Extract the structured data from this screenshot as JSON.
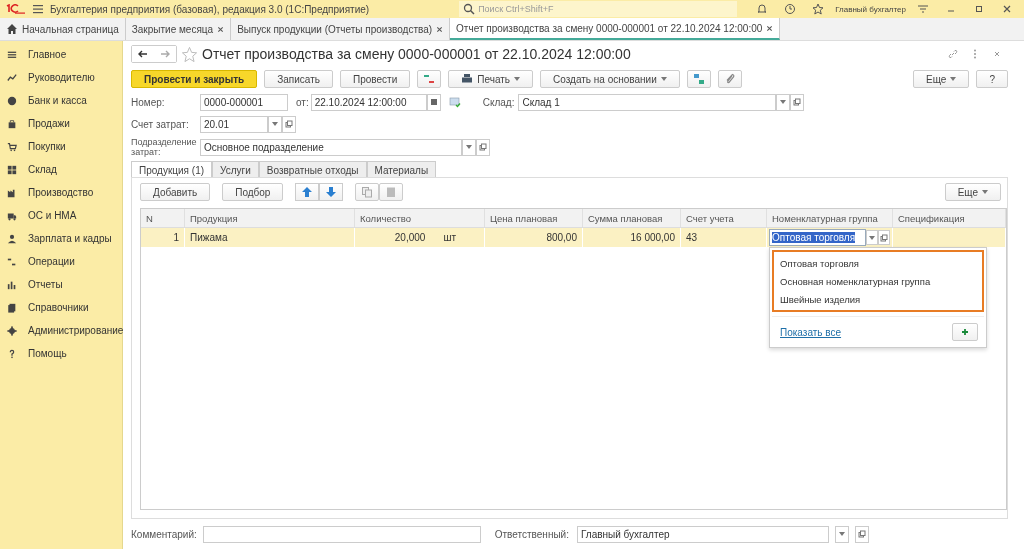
{
  "app_bar": {
    "title": "Бухгалтерия предприятия (базовая), редакция 3.0  (1С:Предприятие)",
    "search": {
      "placeholder": "Поиск Ctrl+Shift+F"
    },
    "user": "Главный бухгалтер"
  },
  "open_tabs": [
    {
      "label": "Начальная страница",
      "kind": "home",
      "selected": false
    },
    {
      "label": "Закрытие месяца",
      "kind": "closable",
      "selected": false
    },
    {
      "label": "Выпуск продукции (Отчеты производства)",
      "kind": "closable",
      "selected": false
    },
    {
      "label": "Отчет производства за смену 0000-000001 от 22.10.2024 12:00:00",
      "kind": "closable",
      "selected": true
    }
  ],
  "sidebar": {
    "items": [
      {
        "label": "Главное"
      },
      {
        "label": "Руководителю"
      },
      {
        "label": "Банк и касса"
      },
      {
        "label": "Продажи"
      },
      {
        "label": "Покупки"
      },
      {
        "label": "Склад"
      },
      {
        "label": "Производство"
      },
      {
        "label": "ОС и НМА"
      },
      {
        "label": "Зарплата и кадры"
      },
      {
        "label": "Операции"
      },
      {
        "label": "Отчеты"
      },
      {
        "label": "Справочники"
      },
      {
        "label": "Администрирование"
      },
      {
        "label": "Помощь"
      }
    ]
  },
  "document": {
    "title": "Отчет производства за смену 0000-000001 от 22.10.2024 12:00:00",
    "toolbar": {
      "post_close": "Провести и закрыть",
      "save": "Записать",
      "post": "Провести",
      "print": "Печать",
      "create_based": "Создать на основании",
      "more": "Еще",
      "help": "?"
    },
    "fields": {
      "number_label": "Номер:",
      "number": "0000-000001",
      "date_label": "от:",
      "date": "22.10.2024 12:00:00",
      "warehouse_label": "Склад:",
      "warehouse": "Склад 1",
      "account_label": "Счет затрат:",
      "account": "20.01",
      "division_label": "Подразделение затрат:",
      "division": "Основное подразделение"
    },
    "tabs": [
      {
        "label": "Продукция (1)",
        "selected": true
      },
      {
        "label": "Услуги",
        "selected": false
      },
      {
        "label": "Возвратные отходы",
        "selected": false
      },
      {
        "label": "Материалы",
        "selected": false
      }
    ],
    "table_toolbar": {
      "add": "Добавить",
      "pick": "Подбор",
      "more": "Еще"
    },
    "table": {
      "columns": [
        "N",
        "Продукция",
        "Количество",
        "Цена плановая",
        "Сумма плановая",
        "Счет учета",
        "Номенклатурная группа",
        "Спецификация"
      ],
      "rows": [
        {
          "n": "1",
          "product": "Пижама",
          "quantity": "20,000",
          "unit": "шт",
          "price": "800,00",
          "sum": "16 000,00",
          "account": "43",
          "group": "Оптовая торговля",
          "selected": true
        }
      ]
    },
    "dropdown": {
      "options": [
        "Оптовая торговля",
        "Основная номенклатурная группа",
        "Швейные изделия"
      ],
      "show_all": "Показать все"
    },
    "footer": {
      "comment_label": "Комментарий:",
      "responsible_label": "Ответственный:",
      "responsible": "Главный бухгалтер"
    }
  }
}
